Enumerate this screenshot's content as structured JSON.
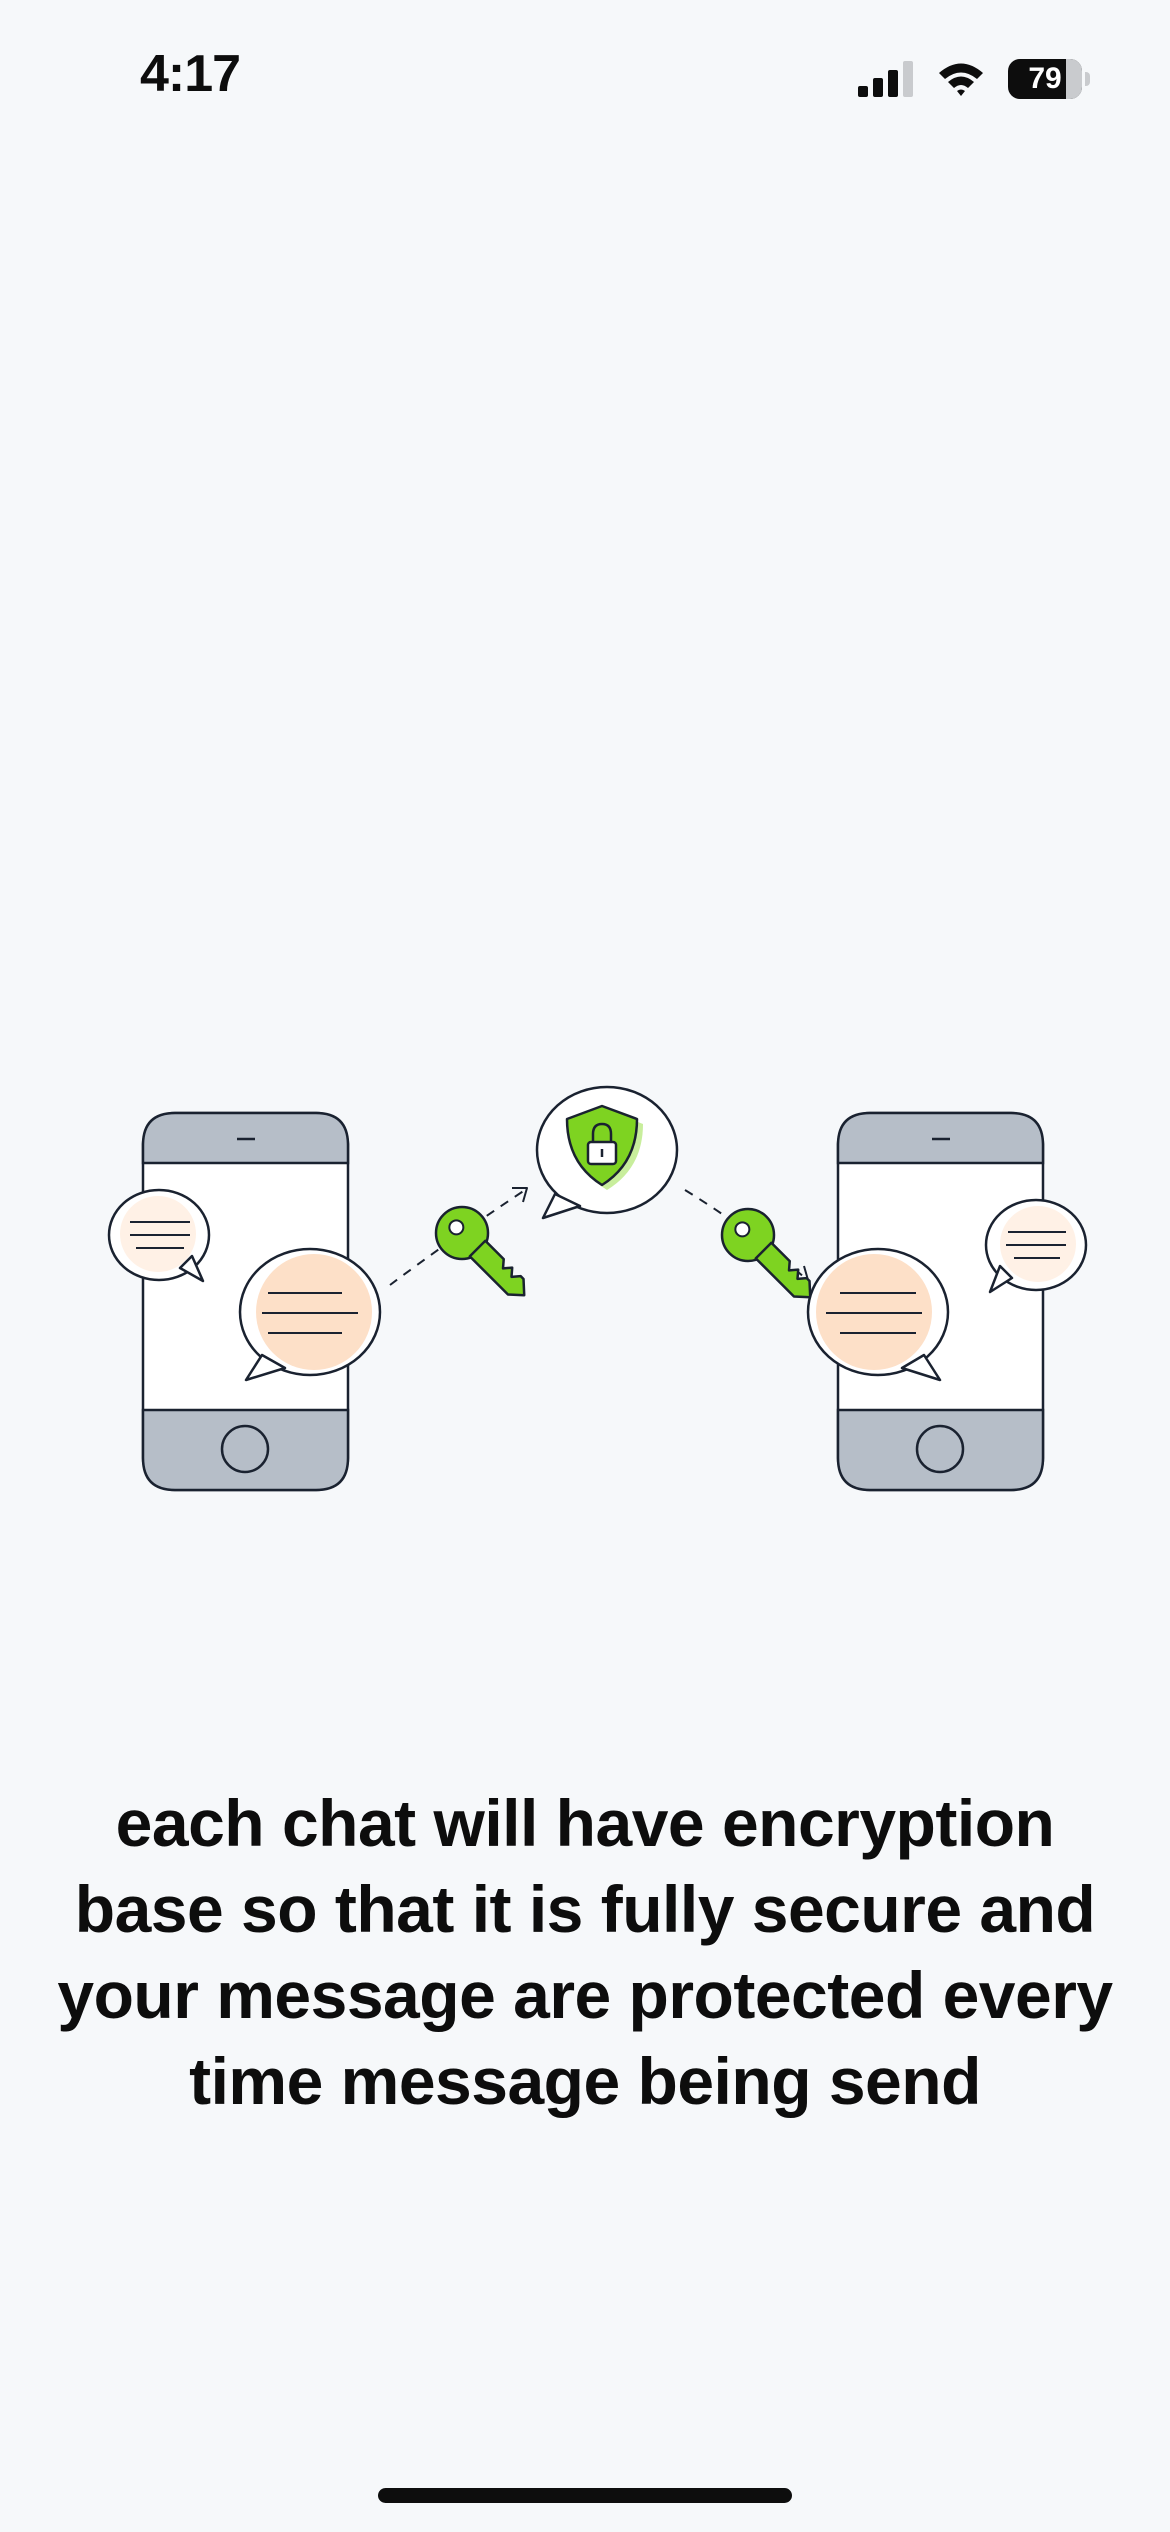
{
  "status_bar": {
    "time": "4:17",
    "battery_level": "79",
    "battery_fraction": 0.79,
    "icons": [
      "cellular-signal-icon",
      "wifi-icon",
      "battery-icon"
    ]
  },
  "illustration": {
    "icons": [
      "phone-icon",
      "chat-bubble-icon",
      "key-icon",
      "shield-lock-icon"
    ],
    "colors": {
      "outline": "#1a2230",
      "phone_bar": "#b6bec8",
      "bubble_fill": "#fde0c8",
      "bubble_fill_light": "#fff1e6",
      "key_green": "#7ed321",
      "shield_green": "#7ed321",
      "screen": "#ffffff"
    }
  },
  "message": {
    "text": "each chat will have encryption base so that it is fully secure and your message are protected every time message being send"
  }
}
